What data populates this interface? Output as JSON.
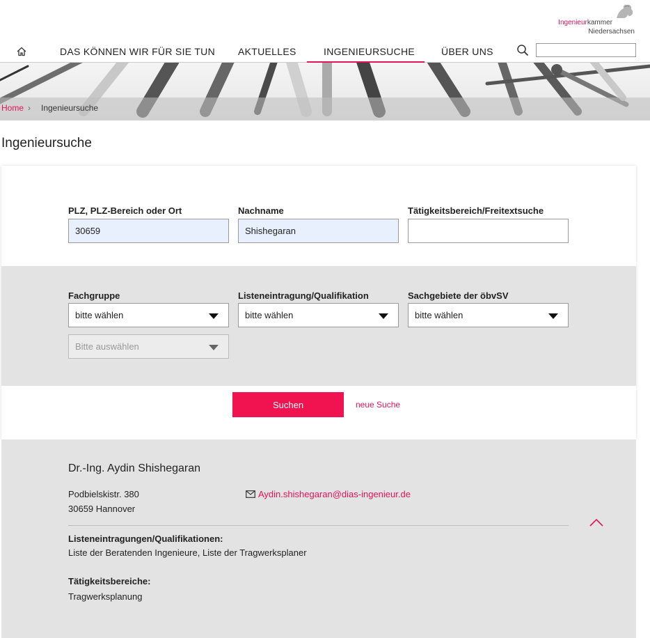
{
  "logo": {
    "text_pink": "Ingenieur",
    "text_grey": "kammer",
    "line2": "Niedersachsen"
  },
  "nav": {
    "items": [
      "DAS KÖNNEN WIR FÜR SIE TUN",
      "AKTUELLES",
      "INGENIEURSUCHE",
      "ÜBER UNS"
    ],
    "active": "INGENIEURSUCHE",
    "search_value": ""
  },
  "breadcrumb": {
    "home": "Home",
    "separator": "›",
    "current": "Ingenieursuche"
  },
  "page_title": "Ingenieursuche",
  "form": {
    "plz": {
      "label": "PLZ, PLZ-Bereich oder Ort",
      "value": "30659"
    },
    "nachname": {
      "label": "Nachname",
      "value": "Shishegaran"
    },
    "freitext": {
      "label": "Tätigkeitsbereich/Freitextsuche",
      "value": ""
    },
    "fachgruppe": {
      "label": "Fachgruppe",
      "value": "bitte wählen"
    },
    "fachgruppe_sub": {
      "value": "Bitte auswählen"
    },
    "listeneintragung": {
      "label": "Listeneintragung/Qualifikation",
      "value": "bitte wählen"
    },
    "sachgebiete": {
      "label": "Sachgebiete der öbvSV",
      "value": "bitte wählen"
    },
    "search_button": "Suchen",
    "reset_link": "neue Suche"
  },
  "result": {
    "name": "Dr.-Ing. Aydin Shishegaran",
    "street": "Podbielskistr. 380",
    "city": "30659 Hannover",
    "email": "Aydin.shishegaran@dias-ingenieur.de",
    "qual_heading": "Listeneintragungen/Qualifikationen:",
    "qual_text": "Liste der Beratenden Ingenieure, Liste der Tragwerksplaner",
    "area_heading": "Tätigkeitsbereiche:",
    "area_text": "Tragwerksplanung"
  },
  "colors": {
    "accent": "#e2135a",
    "button": "#f0134f",
    "band": "#e3e3e3"
  }
}
